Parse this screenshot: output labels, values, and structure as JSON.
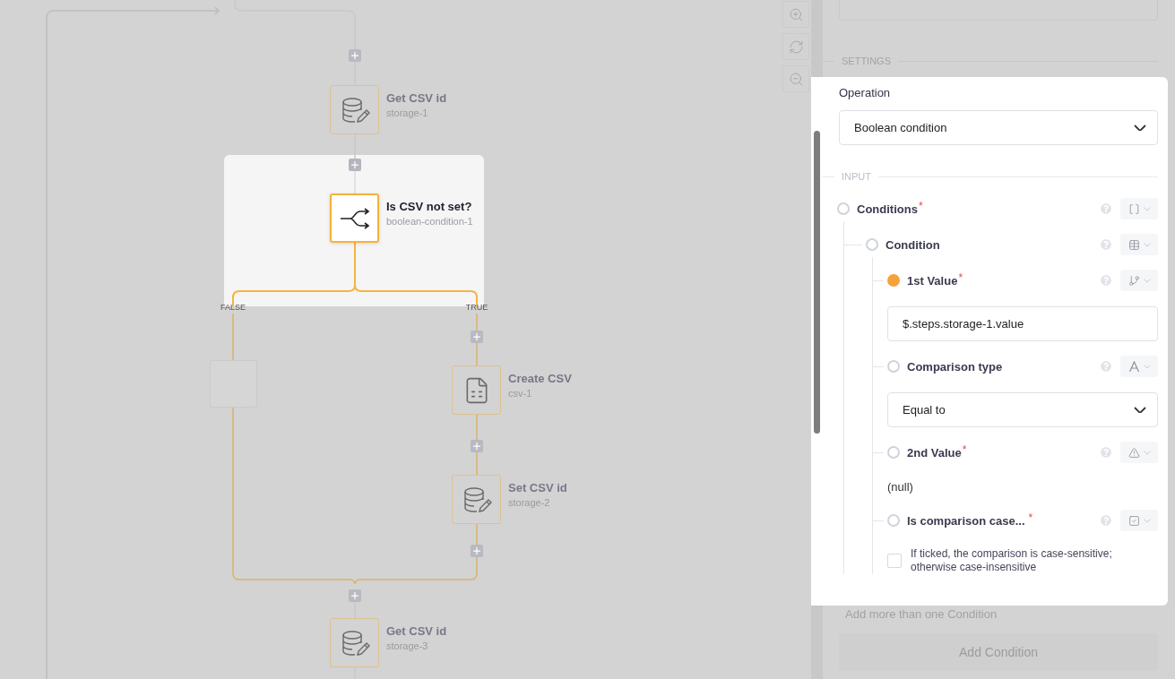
{
  "canvas": {
    "nodes": [
      {
        "kind": "step",
        "title": "Get CSV id",
        "subtitle": "storage-1",
        "highlighted": false
      },
      {
        "kind": "step",
        "title": "Is CSV not set?",
        "subtitle": "boolean-condition-1",
        "highlighted": true
      },
      {
        "kind": "empty",
        "highlighted": false
      },
      {
        "kind": "step",
        "title": "Create CSV",
        "subtitle": "csv-1",
        "highlighted": false
      },
      {
        "kind": "step",
        "title": "Set CSV id",
        "subtitle": "storage-2",
        "highlighted": false
      },
      {
        "kind": "step",
        "title": "Get CSV id",
        "subtitle": "storage-3",
        "highlighted": false
      }
    ],
    "branch_labels": [
      "FALSE",
      "TRUE"
    ]
  },
  "panel": {
    "settings_heading": "SETTINGS",
    "operation": {
      "label": "Operation",
      "value": "Boolean condition"
    },
    "input_heading": "INPUT",
    "fields": [
      {
        "label": "Conditions",
        "required_mark": "*",
        "filled": false,
        "children": [
          {
            "label": "Condition",
            "filled": false,
            "children": [
              {
                "kind": "text_input",
                "label": "1st Value",
                "required_mark": "*",
                "filled": true,
                "value": "$.steps.storage-1.value"
              },
              {
                "kind": "select",
                "label": "Comparison type",
                "filled": false,
                "value": "Equal to"
              },
              {
                "kind": "plain",
                "label": "2nd Value",
                "required_mark": "*",
                "filled": false,
                "value": "(null)"
              },
              {
                "kind": "checkbox",
                "label": "Is comparison case...",
                "required_mark": "*",
                "filled": false,
                "checked": false,
                "description": "If ticked, the comparison is case-sensitive; otherwise case-insensitive"
              }
            ]
          }
        ]
      }
    ],
    "add_hint": "Add more than one Condition",
    "add_button": "Add Condition"
  }
}
